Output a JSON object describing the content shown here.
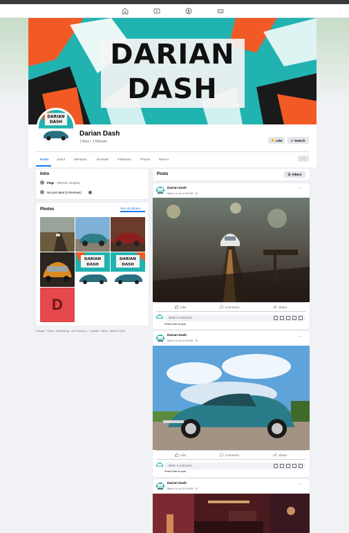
{
  "topnav": {
    "icons": [
      "home-icon",
      "video-icon",
      "groups-icon",
      "gaming-icon"
    ]
  },
  "cover": {
    "line1": "DARIAN",
    "line2": "DASH",
    "colors": {
      "teal": "#21b3b0",
      "orange": "#f15a24",
      "white": "#ffffff",
      "dark": "#1a1a1a"
    }
  },
  "profile": {
    "name": "Darian Dash",
    "stats": "1 likes • 1 follower",
    "avatar_text_1": "DARIAN",
    "avatar_text_2": "DASH",
    "like_button": "Like",
    "search_button": "Search"
  },
  "tabs": [
    {
      "label": "Posts",
      "active": true
    },
    {
      "label": "About"
    },
    {
      "label": "Mentions"
    },
    {
      "label": "Reviews"
    },
    {
      "label": "Followers"
    },
    {
      "label": "Photos"
    },
    {
      "label": "More ▾"
    }
  ],
  "more_button": "···",
  "intro": {
    "title": "Intro",
    "page_bold": "Page",
    "page_rest": " · Internet company",
    "rating": "Not yet rated (0 Reviews)"
  },
  "photos": {
    "title": "Photos",
    "see_all": "See all photos",
    "letter_tile": "D",
    "mini_logo_1": "DARIAN",
    "mini_logo_2": "DASH"
  },
  "footer": "Privacy · Terms · Advertising · Ad Choices ▷ · Cookies · More · Meta © 2023",
  "posts_header": {
    "title": "Posts",
    "filters": "Filters"
  },
  "posts": [
    {
      "author": "Darian Dash",
      "date": "March 14 at 10:30 AM · ◎",
      "like": "Like",
      "comment": "Comment",
      "share": "Share",
      "comment_placeholder": "Write a comment...",
      "enter_hint": "Press Enter to post."
    },
    {
      "author": "Darian Dash",
      "date": "March 14 at 10:28 AM · ◎",
      "like": "Like",
      "comment": "Comment",
      "share": "Share",
      "comment_placeholder": "Write a comment...",
      "enter_hint": "Press Enter to post."
    },
    {
      "author": "Darian Dash",
      "date": "March 14 at 10:26 AM · ◎",
      "dots": "···"
    }
  ],
  "accent": "#1877f2"
}
